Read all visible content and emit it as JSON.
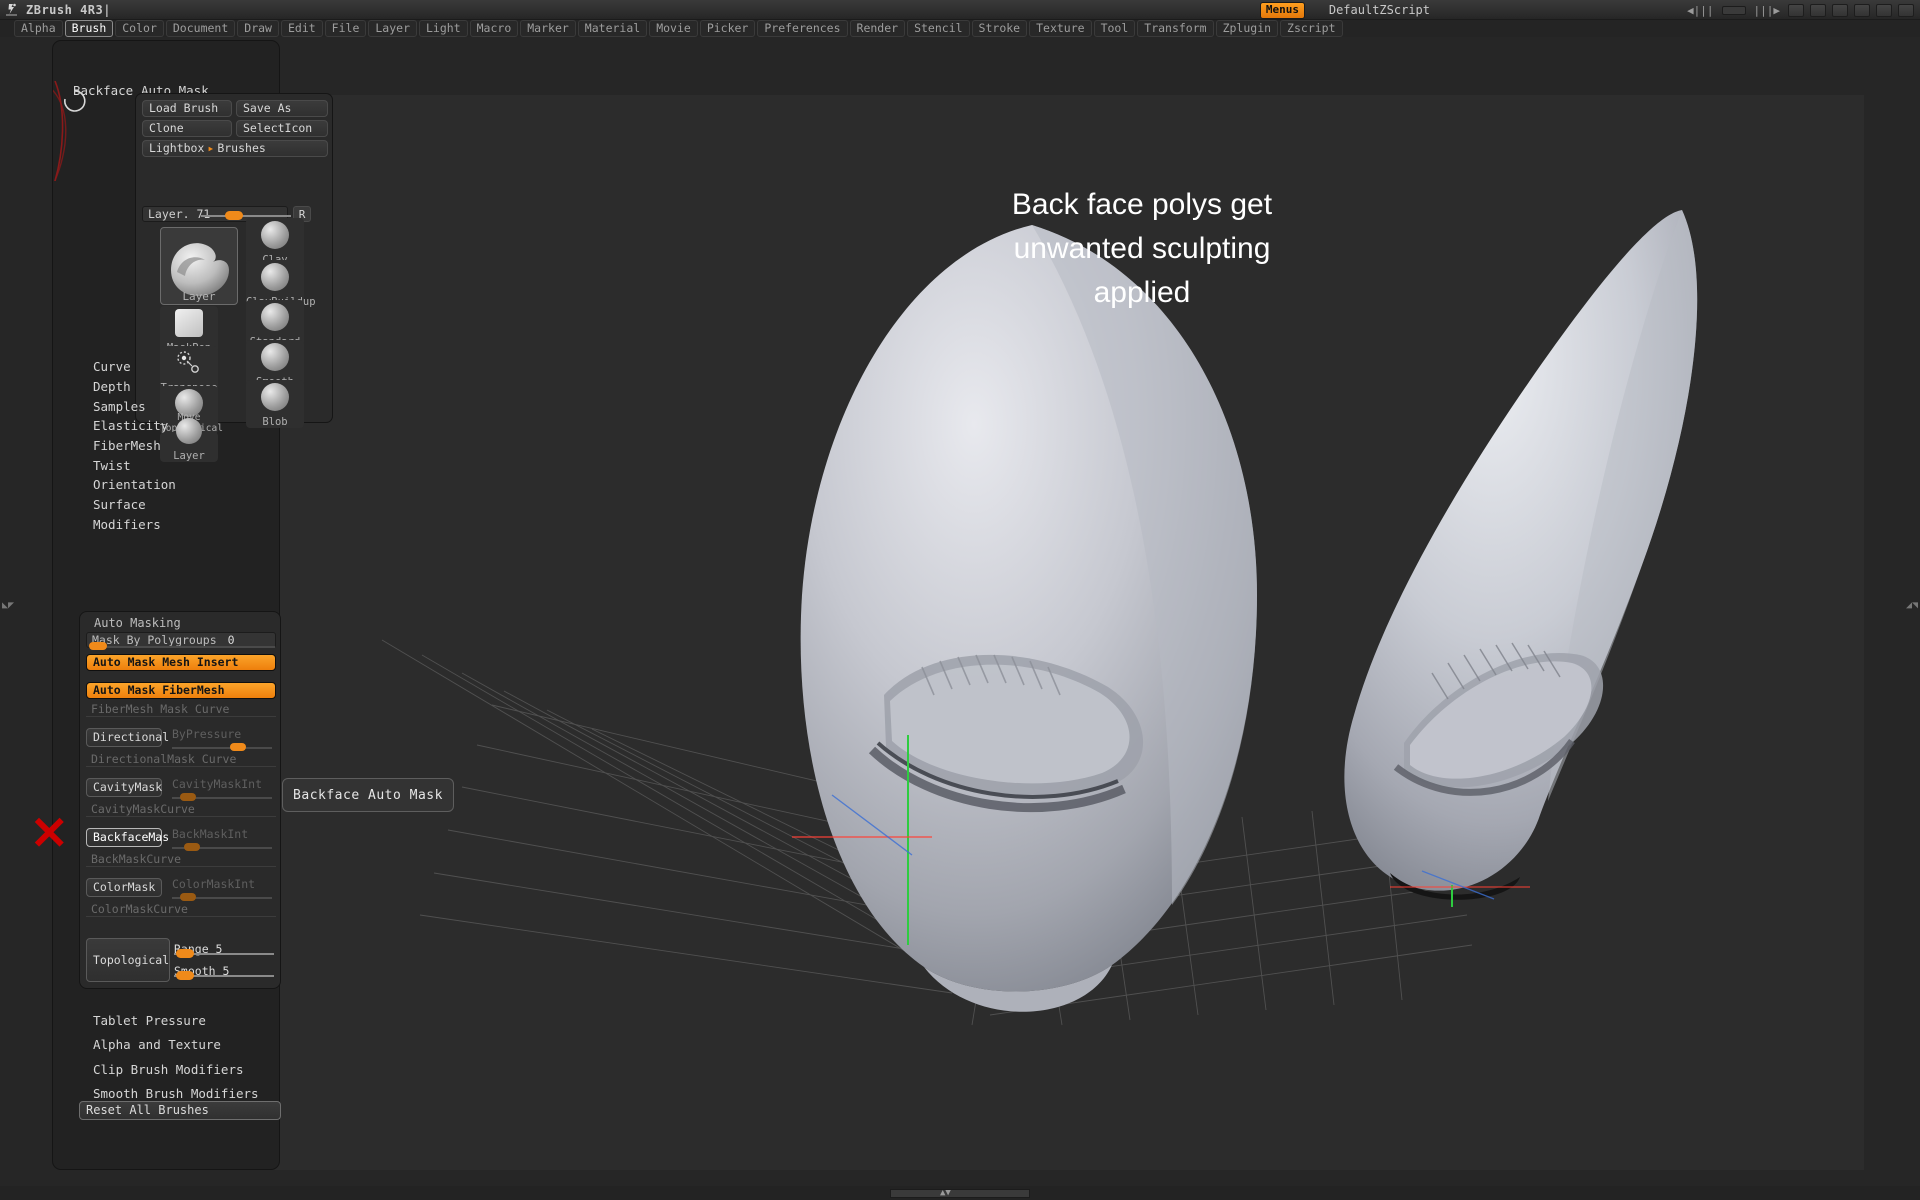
{
  "window": {
    "app_title": "ZBrush 4R3",
    "logo_icon": "zbrush-logo-icon",
    "caret": "|"
  },
  "topbar": {
    "menus_label": "Menus",
    "script_name": "DefaultZScript",
    "icons": [
      "prev-icon",
      "slider-icon",
      "next-icon",
      "layout-icon",
      "dock-icon",
      "lock-icon",
      "minimize-icon",
      "restore-icon",
      "close-icon"
    ],
    "nav_prev": "◀|||",
    "nav_next": "|||▶",
    "minimize": "▬",
    "restore": "❐",
    "close": "✕"
  },
  "menubar": {
    "items": [
      {
        "label": "Alpha",
        "active": false
      },
      {
        "label": "Brush",
        "active": true
      },
      {
        "label": "Color",
        "active": false
      },
      {
        "label": "Document",
        "active": false
      },
      {
        "label": "Draw",
        "active": false
      },
      {
        "label": "Edit",
        "active": false
      },
      {
        "label": "File",
        "active": false
      },
      {
        "label": "Layer",
        "active": false
      },
      {
        "label": "Light",
        "active": false
      },
      {
        "label": "Macro",
        "active": false
      },
      {
        "label": "Marker",
        "active": false
      },
      {
        "label": "Material",
        "active": false
      },
      {
        "label": "Movie",
        "active": false
      },
      {
        "label": "Picker",
        "active": false
      },
      {
        "label": "Preferences",
        "active": false
      },
      {
        "label": "Render",
        "active": false
      },
      {
        "label": "Stencil",
        "active": false
      },
      {
        "label": "Stroke",
        "active": false
      },
      {
        "label": "Texture",
        "active": false
      },
      {
        "label": "Tool",
        "active": false
      },
      {
        "label": "Transform",
        "active": false
      },
      {
        "label": "Zplugin",
        "active": false
      },
      {
        "label": "Zscript",
        "active": false
      }
    ]
  },
  "brush_palette": {
    "backface_label": "Backface",
    "auto_mask_label": "Auto Mask",
    "buttons": {
      "load_brush": "Load Brush",
      "save_as": "Save As",
      "clone": "Clone",
      "select_icon": "SelectIcon",
      "lightbox": "Lightbox",
      "lightbox_arrow": "▸",
      "lightbox_brushes": "Brushes"
    },
    "layer_slider": {
      "label": "Layer. 71",
      "r_button": "R"
    },
    "selected_brush": "Layer",
    "brush_grid": [
      {
        "name": "MaskPen",
        "icon": "maskpen-brush-icon"
      },
      {
        "name": "Clay",
        "icon": "clay-brush-icon"
      },
      {
        "name": "Transpose",
        "icon": "transpose-brush-icon"
      },
      {
        "name": "ClayBuildup",
        "icon": "claybuildup-brush-icon"
      },
      {
        "name": "Move Topological",
        "icon": "move-topological-brush-icon"
      },
      {
        "name": "Standard",
        "icon": "standard-brush-icon"
      },
      {
        "name": "Layer",
        "icon": "layer-brush-icon"
      },
      {
        "name": "Smooth",
        "icon": "smooth-brush-icon"
      },
      {
        "name": "Blob",
        "icon": "blob-brush-icon"
      }
    ],
    "sections": [
      "Curve",
      "Depth",
      "Samples",
      "Elasticity",
      "FiberMesh",
      "Twist",
      "Orientation",
      "Surface",
      "Modifiers"
    ],
    "bottom_sections": [
      "Tablet Pressure",
      "Alpha and Texture",
      "Clip Brush Modifiers",
      "Smooth Brush Modifiers"
    ],
    "reset_all_brushes": "Reset All Brushes"
  },
  "auto_masking": {
    "title": "Auto Masking",
    "mask_by_polygroups": {
      "label": "Mask By Polygroups",
      "value": "0"
    },
    "auto_mask_mesh_insert": "Auto Mask Mesh Insert",
    "auto_mask_fibermesh": "Auto Mask FiberMesh",
    "fibermesh_mask_curve": "FiberMesh Mask Curve",
    "directional": "Directional",
    "by_pressure": "ByPressure",
    "directional_mask_curve": "DirectionalMask Curve",
    "cavity_mask": "CavityMask",
    "cavity_mask_int": "CavityMaskInt",
    "cavity_mask_curve": "CavityMaskCurve",
    "backface_mask": "BackfaceMas",
    "back_mask_int": "BackMaskInt",
    "back_mask_curve": "BackMaskCurve",
    "color_mask": "ColorMask",
    "color_mask_int": "ColorMaskInt",
    "color_mask_curve": "ColorMaskCurve",
    "topological": "Topological",
    "range": "Range 5",
    "smooth": "Smooth 5"
  },
  "tooltip": {
    "text": "Backface Auto Mask"
  },
  "annotation": {
    "note_line1": "Back face polys get",
    "note_line2": "unwanted sculpting",
    "note_line3": "applied",
    "red_x": "✕"
  },
  "colors": {
    "accent_orange": "#f08a1a",
    "panel_bg": "#2a2a2a",
    "app_bg": "#262626",
    "canvas_bg": "#2c2c2c",
    "text_primary": "#d8d8d8",
    "text_dim": "#6a6a6a",
    "red_marker": "#cc0000"
  },
  "statusbar": {
    "scroll_arrows": "▲▼"
  }
}
